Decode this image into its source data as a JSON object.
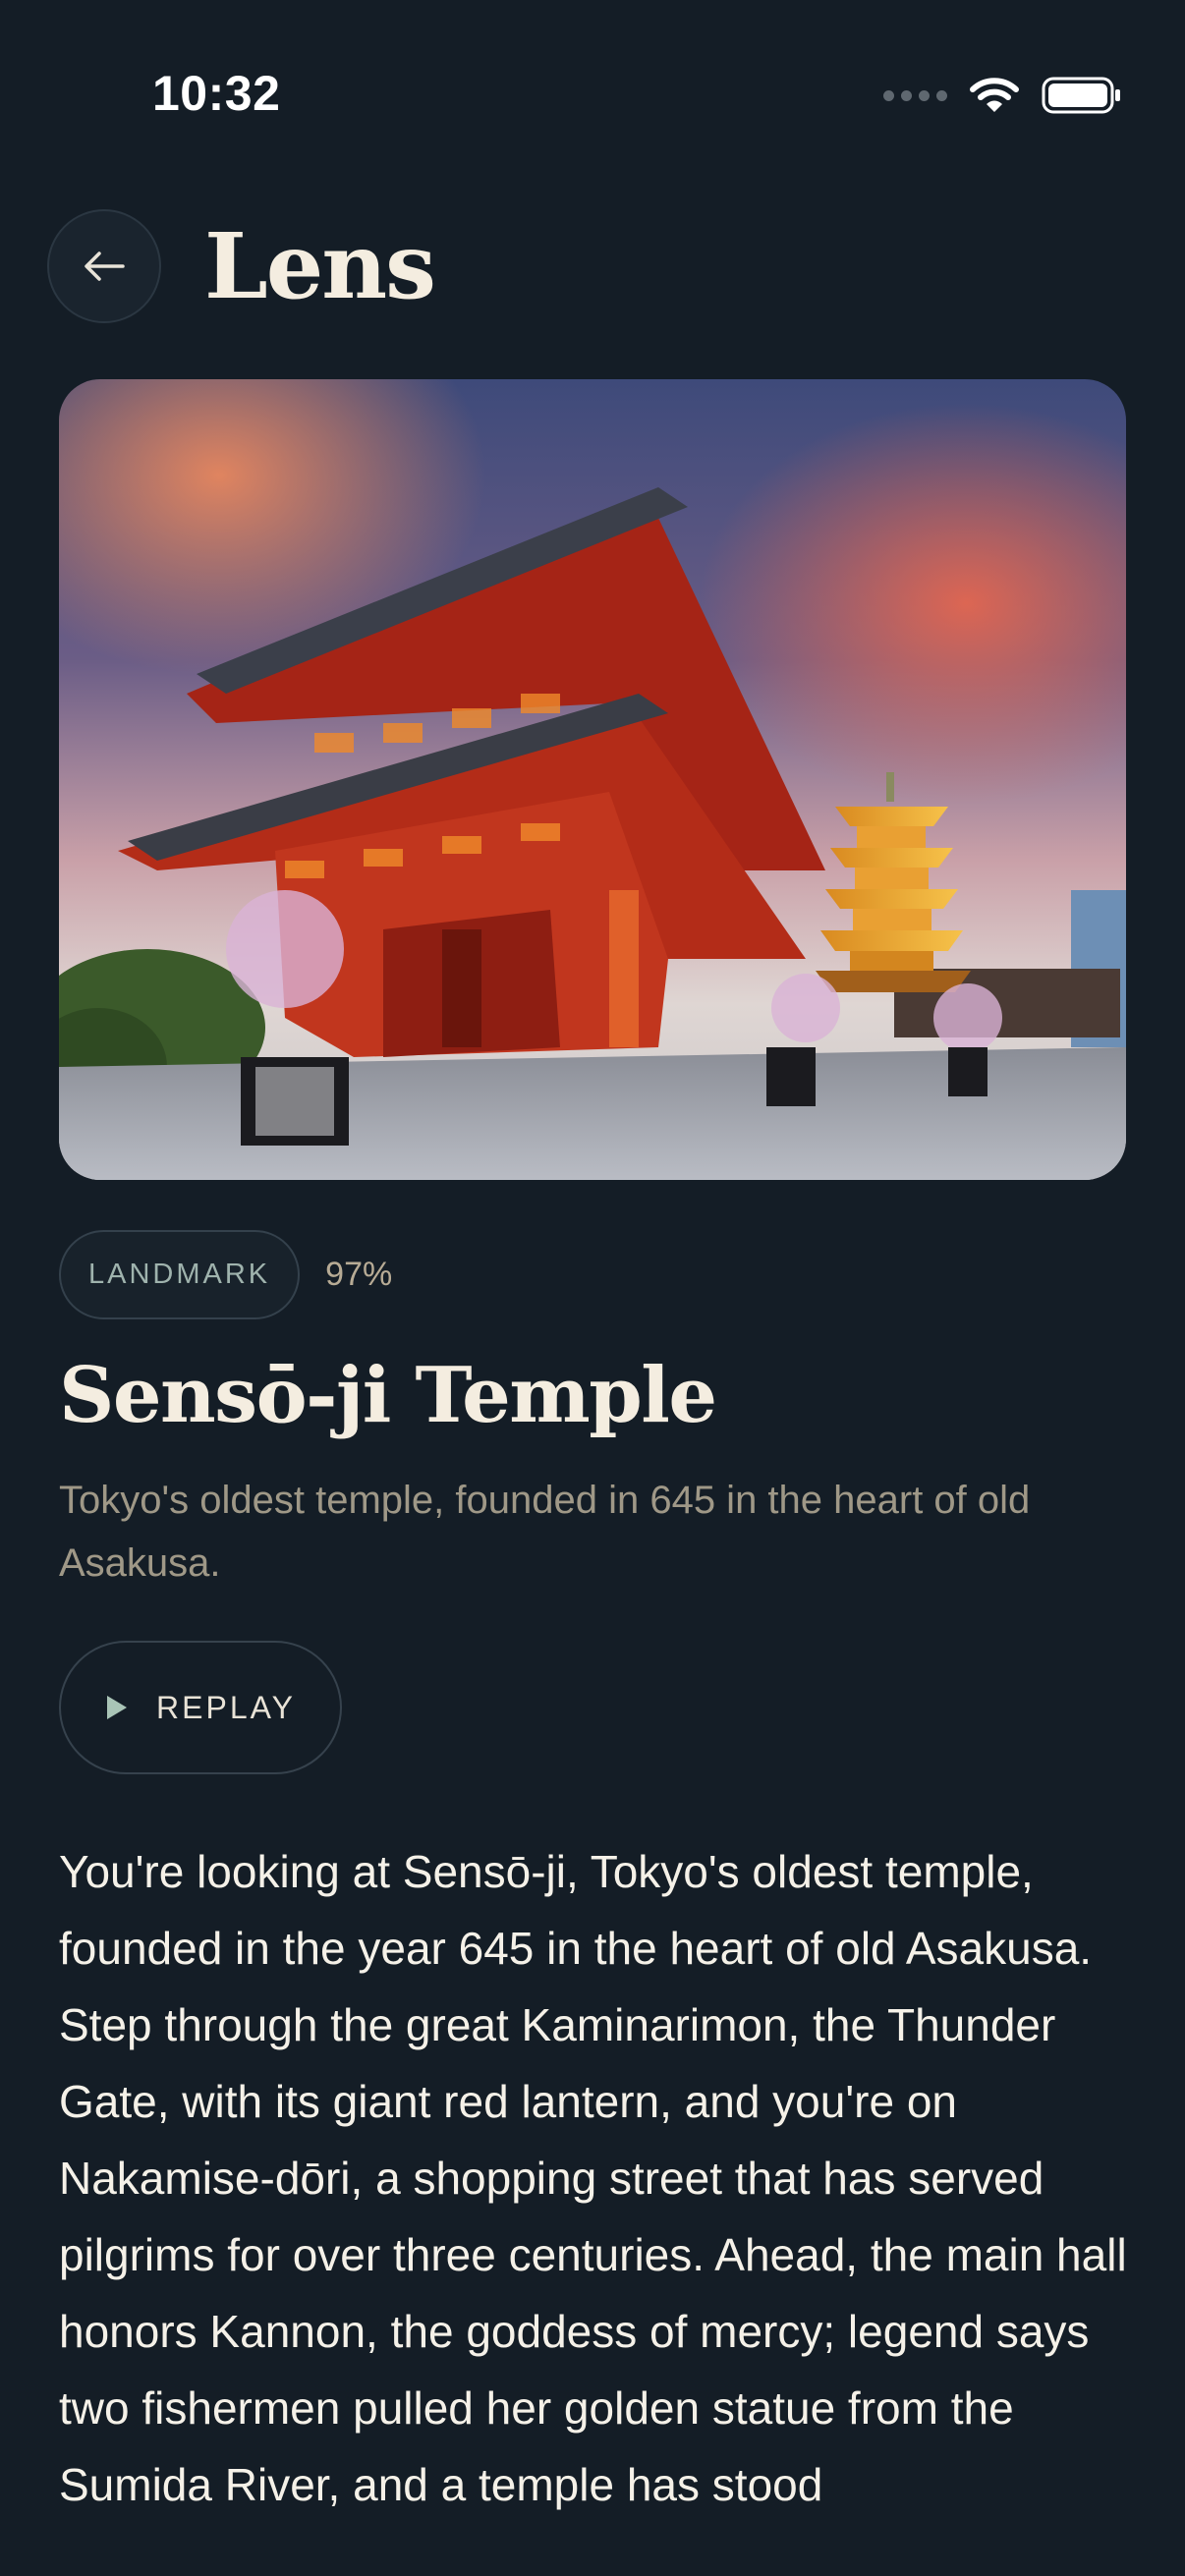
{
  "status_bar": {
    "time": "10:32",
    "icons": [
      "signal-icon",
      "wifi-icon",
      "battery-icon"
    ]
  },
  "header": {
    "back_icon": "back-arrow-icon",
    "title": "Lens"
  },
  "hero": {
    "alt": "Sensō-ji Temple photo"
  },
  "result": {
    "category": "LANDMARK",
    "confidence": "97%",
    "title": "Sensō-ji Temple",
    "subtitle": "Tokyo's oldest temple, founded in 645 in the heart of old Asakusa."
  },
  "replay": {
    "icon": "play-icon",
    "label": "REPLAY"
  },
  "narration": "You're looking at Sensō-ji, Tokyo's oldest temple, founded in the year 645 in the heart of old Asakusa. Step through the great Kaminarimon, the Thunder Gate, with its giant red lantern, and you're on Nakamise-dōri, a shopping street that has served pilgrims for over three centuries. Ahead, the main hall honors Kannon, the goddess of mercy; legend says two fishermen pulled her golden statue from the Sumida River, and a temple has stood",
  "colors": {
    "background": "#141d26",
    "accent_text": "#f4ede0",
    "muted_text": "#9f9887",
    "badge_text": "#9fb3ad",
    "confidence_text": "#b7ab95"
  }
}
